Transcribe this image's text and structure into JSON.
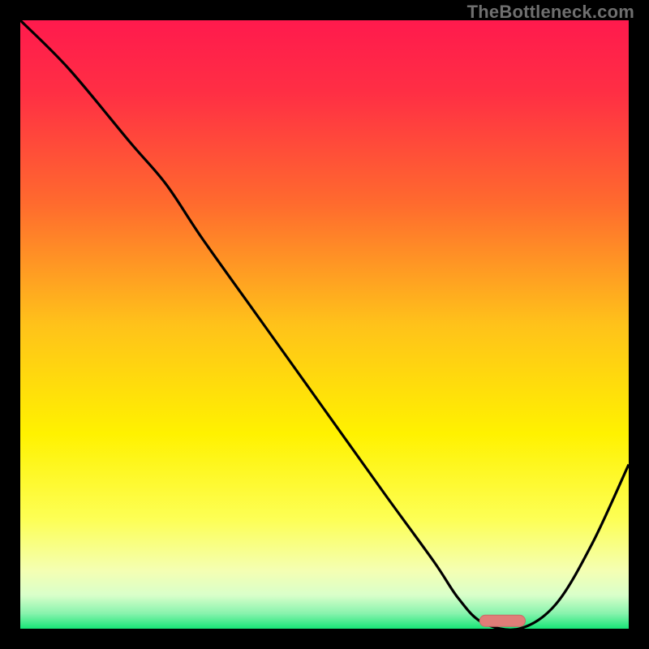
{
  "watermark": "TheBottleneck.com",
  "colors": {
    "bg": "#000000",
    "gradient_stops": [
      {
        "offset": 0.0,
        "color": "#ff1a4d"
      },
      {
        "offset": 0.12,
        "color": "#ff2f44"
      },
      {
        "offset": 0.3,
        "color": "#ff6a2e"
      },
      {
        "offset": 0.5,
        "color": "#ffc21a"
      },
      {
        "offset": 0.68,
        "color": "#fff200"
      },
      {
        "offset": 0.82,
        "color": "#fdff55"
      },
      {
        "offset": 0.905,
        "color": "#f4ffb3"
      },
      {
        "offset": 0.945,
        "color": "#d9ffca"
      },
      {
        "offset": 0.975,
        "color": "#88f3ad"
      },
      {
        "offset": 1.0,
        "color": "#17e577"
      }
    ],
    "curve": "#000000",
    "marker_fill": "#e17d78",
    "marker_stroke": "#c86b66"
  },
  "chart_data": {
    "type": "line",
    "title": "",
    "xlabel": "",
    "ylabel": "",
    "xlim": [
      0,
      100
    ],
    "ylim": [
      0,
      100
    ],
    "series": [
      {
        "name": "bottleneck-curve",
        "x": [
          0,
          8,
          18,
          24,
          30,
          40,
          50,
          60,
          68,
          72,
          76,
          82,
          88,
          94,
          100
        ],
        "values": [
          100,
          92,
          80,
          73,
          64,
          50,
          36,
          22,
          11,
          5,
          1,
          0,
          4,
          14,
          27
        ]
      }
    ],
    "marker": {
      "x_start": 75.5,
      "x_end": 83,
      "y": 1.3,
      "rx": 2.4
    }
  }
}
